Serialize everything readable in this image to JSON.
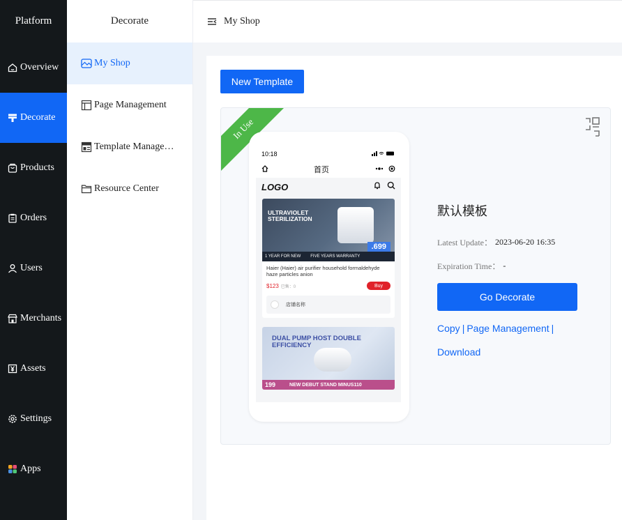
{
  "sidebar": {
    "brand": "Platform",
    "items": [
      {
        "label": "Overview",
        "icon": "home-icon"
      },
      {
        "label": "Decorate",
        "icon": "decorate-icon",
        "active": true
      },
      {
        "label": "Products",
        "icon": "bag-icon"
      },
      {
        "label": "Orders",
        "icon": "clipboard-icon"
      },
      {
        "label": "Users",
        "icon": "user-icon"
      },
      {
        "label": "Merchants",
        "icon": "store-icon"
      },
      {
        "label": "Assets",
        "icon": "yen-icon"
      },
      {
        "label": "Settings",
        "icon": "gear-icon"
      },
      {
        "label": "Apps",
        "icon": "apps-grid-icon"
      }
    ]
  },
  "subnav": {
    "title": "Decorate",
    "items": [
      {
        "label": "My Shop",
        "icon": "shop-image-icon",
        "active": true
      },
      {
        "label": "Page Management",
        "icon": "layout-icon"
      },
      {
        "label": "Template Manage…",
        "icon": "template-icon"
      },
      {
        "label": "Resource Center",
        "icon": "folder-icon"
      }
    ]
  },
  "header": {
    "title": "My Shop",
    "icon": "menu-collapse-icon"
  },
  "main": {
    "new_template_label": "New Template",
    "card": {
      "ribbon_label": "In Use",
      "template_name": "默认模板",
      "latest_update_label": "Latest Update：",
      "latest_update_value": "2023-06-20 16:35",
      "expiration_label": "Expiration Time：",
      "expiration_value": "-",
      "go_decorate_label": "Go Decorate",
      "copy_label": "Copy",
      "page_management_label": "Page Management",
      "download_label": "Download",
      "separator": "|"
    },
    "preview": {
      "time": "10:18",
      "page_title": "首页",
      "logo": "LOGO",
      "product1": {
        "image_title": "ULTRAVIOLET STERILIZATION",
        "band_left": "1 YEAR FOR NEW",
        "band_right": "FIVE YEARS WARRANTY",
        "price_tag": ".699",
        "name": "Haier (Haier) air purifier household formaldehyde haze particles anion",
        "price": "$123",
        "sold": "已售：0",
        "buy": "Buy",
        "shop": "店铺名称"
      },
      "product2": {
        "image_title": "DUAL PUMP HOST DOUBLE EFFICIENCY",
        "band_left": "199",
        "band_right": "NEW DEBUT STAND MINUS110"
      }
    }
  },
  "colors": {
    "sidebar_bg": "#14181b",
    "accent": "#1167f5",
    "ribbon": "#4db748",
    "active_sub_bg": "#e7f1fd"
  }
}
